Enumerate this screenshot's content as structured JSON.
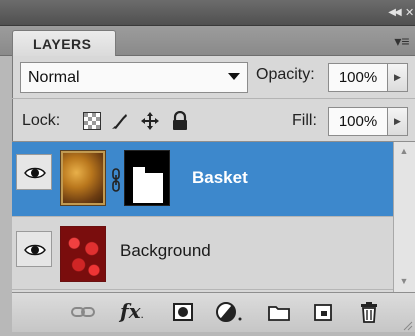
{
  "panel": {
    "tab_title": "LAYERS",
    "blend_mode": "Normal",
    "opacity_label": "Opacity:",
    "opacity_value": "100%",
    "lock_label": "Lock:",
    "fill_label": "Fill:",
    "fill_value": "100%"
  },
  "layers": [
    {
      "name": "Basket",
      "selected": true,
      "visible": true,
      "has_mask": true
    },
    {
      "name": "Background",
      "selected": false,
      "visible": true,
      "has_mask": false
    }
  ],
  "colors": {
    "selection": "#3d88cc",
    "panel_bg": "#d8d8d8"
  },
  "icons": {
    "topbar": [
      "collapse-icon",
      "close-icon"
    ],
    "lock": [
      "lock-transparent-pixels-icon",
      "lock-image-pixels-icon",
      "lock-position-icon",
      "lock-all-icon"
    ],
    "bottom_toolbar": [
      "link-layers-icon",
      "layer-style-fx-icon",
      "add-mask-icon",
      "adjustment-layer-icon",
      "new-group-icon",
      "new-layer-icon",
      "delete-layer-icon"
    ]
  },
  "toolbar": {
    "fx_label": "fx"
  }
}
